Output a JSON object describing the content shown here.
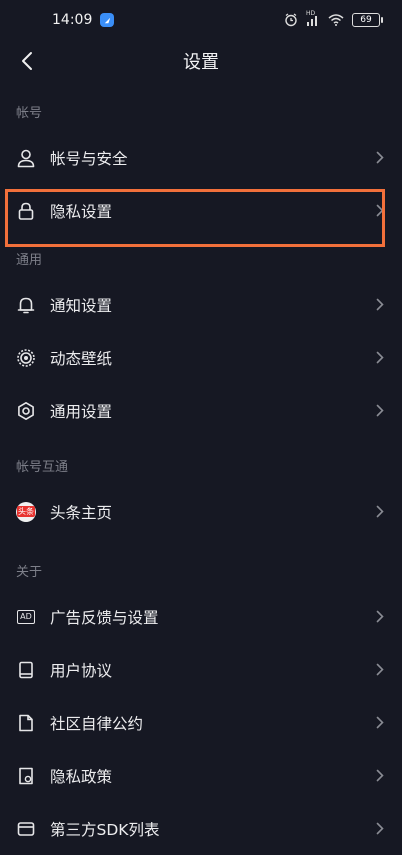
{
  "status": {
    "time": "14:09",
    "battery": "69",
    "net": "HD"
  },
  "header": {
    "title": "设置"
  },
  "sections": {
    "account": {
      "label": "帐号",
      "items": [
        {
          "label": "帐号与安全",
          "icon": "person-icon"
        },
        {
          "label": "隐私设置",
          "icon": "lock-icon"
        }
      ]
    },
    "general": {
      "label": "通用",
      "items": [
        {
          "label": "通知设置",
          "icon": "bell-icon"
        },
        {
          "label": "动态壁纸",
          "icon": "wallpaper-icon"
        },
        {
          "label": "通用设置",
          "icon": "gear-icon"
        }
      ]
    },
    "interop": {
      "label": "帐号互通",
      "items": [
        {
          "label": "头条主页",
          "icon": "toutiao-logo-icon",
          "logo_text": "头条"
        }
      ]
    },
    "about": {
      "label": "关于",
      "items": [
        {
          "label": "广告反馈与设置",
          "icon": "ad-icon",
          "icon_text": "AD"
        },
        {
          "label": "用户协议",
          "icon": "book-icon"
        },
        {
          "label": "社区自律公约",
          "icon": "document-icon"
        },
        {
          "label": "隐私政策",
          "icon": "shield-document-icon"
        },
        {
          "label": "第三方SDK列表",
          "icon": "card-icon"
        }
      ]
    }
  },
  "colors": {
    "background": "#161823",
    "highlight": "#f2703b",
    "muted": "#7d7f89"
  }
}
